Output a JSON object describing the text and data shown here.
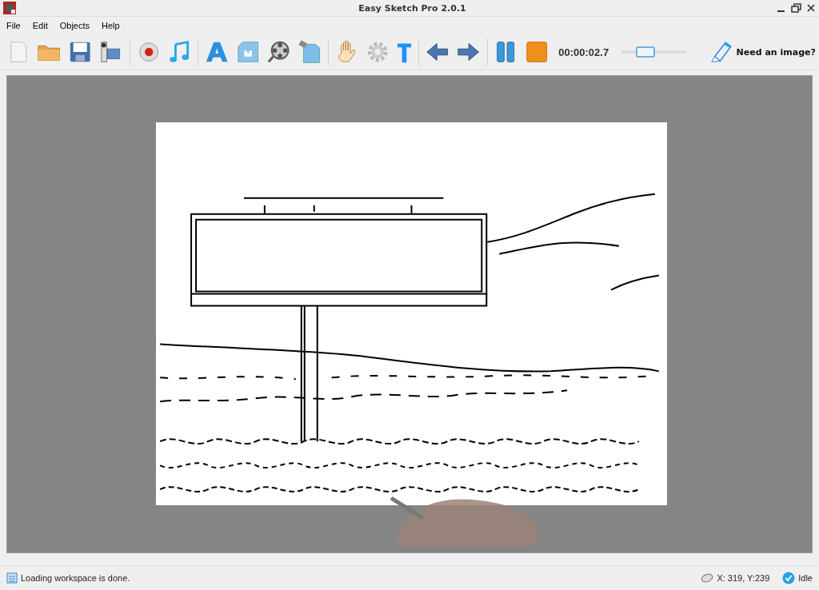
{
  "window": {
    "title": "Easy Sketch Pro 2.0.1"
  },
  "menu": [
    "File",
    "Edit",
    "Objects",
    "Help"
  ],
  "toolbar": {
    "time": "00:00:02.7",
    "speed_slider": {
      "level": 0.3
    },
    "need_image": "Need an image?"
  },
  "status_bar": {
    "message": "Loading workspace is done.",
    "coordinates": "X: 319, Y:239",
    "state": "Idle"
  }
}
